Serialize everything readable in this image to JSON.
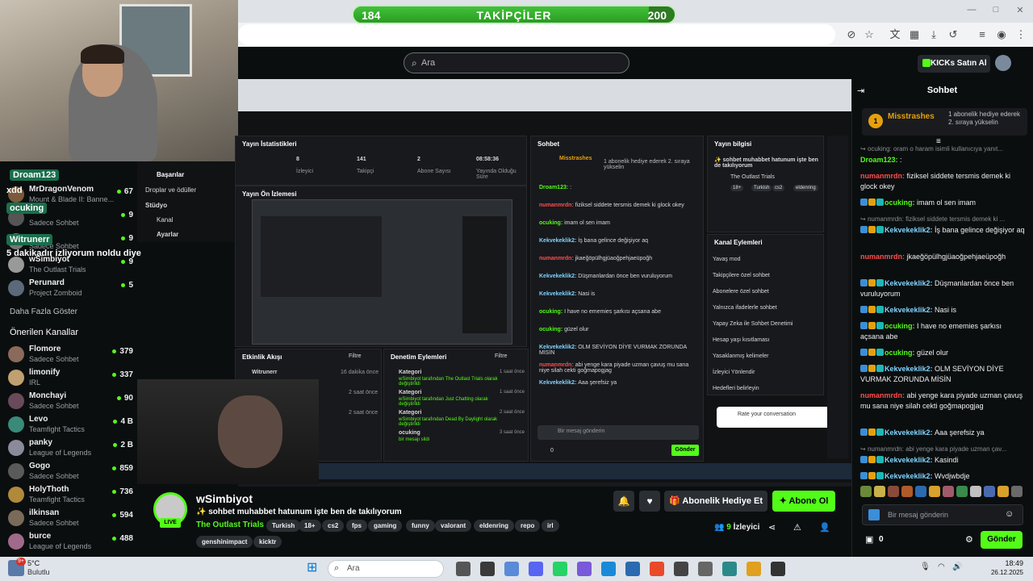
{
  "goal": {
    "title": "TAKİPÇİLER",
    "current": "184",
    "target": "200",
    "progress": 0.92
  },
  "header": {
    "search_placeholder": "Ara",
    "buy_kicks": "KICKs Satın Al"
  },
  "overlay": {
    "labels": [
      "Droam123",
      "xdd",
      "ocuking",
      "Witrunerr",
      "5 dakikadır izliyorum noldu diye"
    ]
  },
  "sidebar": {
    "followed": [
      {
        "name": "MrDragonVenom",
        "category": "Mount & Blade II: Banne...",
        "viewers": "67",
        "color": "#7a5a3a"
      },
      {
        "name": "",
        "category": "Sadece Sohbet",
        "viewers": "9",
        "color": "#555"
      },
      {
        "name": "",
        "category": "Sadece Sohbet",
        "viewers": "9",
        "color": "#777"
      },
      {
        "name": "wSimbiyot",
        "category": "The Outlast Trials",
        "viewers": "9",
        "color": "#999"
      },
      {
        "name": "Perunard",
        "category": "Project Zomboid",
        "viewers": "5",
        "color": "#5a6a7a"
      }
    ],
    "show_more": "Daha Fazla Göster",
    "recommended_title": "Önerilen Kanallar",
    "recommended": [
      {
        "name": "Flomore",
        "category": "Sadece Sohbet",
        "viewers": "379",
        "color": "#8a6a5a"
      },
      {
        "name": "limonify",
        "category": "IRL",
        "viewers": "337",
        "color": "#c0a070"
      },
      {
        "name": "Monchayi",
        "category": "Sadece Sohbet",
        "viewers": "90",
        "color": "#6a4a5a"
      },
      {
        "name": "Levo",
        "category": "Teamfight Tactics",
        "viewers": "4 B",
        "color": "#3a8a7a"
      },
      {
        "name": "panky",
        "category": "League of Legends",
        "viewers": "2 B",
        "color": "#8a8a9a"
      },
      {
        "name": "Gogo",
        "category": "Sadece Sohbet",
        "viewers": "859",
        "color": "#5a5a5a"
      },
      {
        "name": "HolyThoth",
        "category": "Teamfight Tactics",
        "viewers": "736",
        "color": "#b08a3a"
      },
      {
        "name": "ilkinsan",
        "category": "Sadece Sohbet",
        "viewers": "594",
        "color": "#7a6a5a"
      },
      {
        "name": "burce",
        "category": "League of Legends",
        "viewers": "488",
        "color": "#a06a8a"
      }
    ]
  },
  "inner": {
    "stats_title": "Yayın İstatistikleri",
    "stats": [
      {
        "v": "8",
        "l": "İzleyici"
      },
      {
        "v": "141",
        "l": "Takipçi"
      },
      {
        "v": "2",
        "l": "Abone Sayısı"
      },
      {
        "v": "08:58:36",
        "l": "Yayında Olduğu Süre"
      }
    ],
    "preview_title": "Yayın Ön İzlemesi",
    "menu": [
      "Başarılar",
      "Droplar ve ödüller",
      "Stüdyo",
      "Kanal",
      "Ayarlar"
    ],
    "activity_title": "Etkinlik Akışı",
    "activity_filter": "Filtre",
    "activity": [
      {
        "u": "Witrunerr",
        "t": "16 dakika önce"
      },
      {
        "u": "",
        "t": "2 saat önce"
      },
      {
        "u": "",
        "t": "2 saat önce"
      }
    ],
    "moderation_title": "Denetim Eylemleri",
    "moderation_filter": "Filtre",
    "moderation": [
      {
        "k": "Kategori",
        "d": "wSimbiyot tarafından The Outlast Trials olarak değiştirildi",
        "t": "1 saat önce"
      },
      {
        "k": "Kategori",
        "d": "wSimbiyot tarafından Just Chatting olarak değiştirildi",
        "t": "1 saat önce"
      },
      {
        "k": "Kategori",
        "d": "wSimbiyot tarafından Dead By Daylight olarak değiştirildi",
        "t": "2 saat önce"
      },
      {
        "k": "ocuking",
        "d": "bir mesajı sildi",
        "t": "3 saat önce"
      }
    ],
    "chat_title": "Sohbet",
    "info_title": "Yayın bilgisi",
    "info_stream_title": "✨ sohbet muhabbet hatunum işte ben de takılıyorum",
    "info_category": "The Outlast Trials",
    "info_tags": [
      "18+",
      "Turkish",
      "cs2",
      "eldenring"
    ],
    "actions_title": "Kanal Eylemleri",
    "actions": [
      "Yavaş mod",
      "Takipçilere özel sohbet",
      "Abonelere özel sohbet",
      "Yalnızca ifadelerle sohbet",
      "Yapay Zeka ile Sohbet Denetimi",
      "Hesap yaşı kısıtlaması",
      "Yasaklanmış kelimeler",
      "İzleyici Yönlendir",
      "Hedefleri belirleyin"
    ],
    "chat_input": "Bir mesaj gönderin",
    "send": "Gönder",
    "rate": "Rate your conversation",
    "inner_count": "0"
  },
  "stream": {
    "streamer": "wSimbiyot",
    "live": "LIVE",
    "title": "✨ sohbet muhabbet hatunum işte ben de takılıyorum",
    "category": "The Outlast Trials",
    "tags": [
      "Turkish",
      "18+",
      "cs2",
      "fps",
      "gaming",
      "funny",
      "valorant",
      "eldenring",
      "repo",
      "irl",
      "genshinimpact",
      "kicktr"
    ],
    "gift_label": "Abonelik Hediye Et",
    "sub_label": "Abone Ol",
    "viewers": "9",
    "viewers_label": "İzleyici"
  },
  "chat": {
    "title": "Sohbet",
    "pinned_user": "Misstrashes",
    "pinned_count": "1",
    "pinned_text": "1 abonelik hediye ederek 2. sıraya yükselin",
    "messages": [
      {
        "reply": "ocuking: oram o haram isimli kullanıcıya yanıt...",
        "user": "Droam123",
        "text": ":",
        "color": "#53fc18",
        "badges": []
      },
      {
        "user": "numanmrdn",
        "text": "fiziksel siddete tersmis demek ki glock okey",
        "color": "#ff4d4d",
        "badges": []
      },
      {
        "user": "ocuking",
        "text": "imam ol sen imam",
        "color": "#53fc18",
        "badges": [
          "#3a8fd8",
          "#e5a00d",
          "#1fb6b6"
        ]
      },
      {
        "reply": "numanmrdn: fiziksel siddete tersmis demek ki ...",
        "user": "Kekvekeklik2",
        "text": "İş bana gelince değişiyor aq",
        "color": "#7fd3ff",
        "badges": [
          "#3a8fd8",
          "#e5a00d",
          "#1fb6b6"
        ]
      },
      {
        "user": "numanmrdn",
        "text": "jkaeğöpülhgjüaoğpehjaeüpoğh",
        "color": "#ff4d4d",
        "badges": []
      },
      {
        "user": "Kekvekeklik2",
        "text": "Düşmanlardan önce ben vuruluyorum",
        "color": "#7fd3ff",
        "badges": [
          "#3a8fd8",
          "#e5a00d",
          "#1fb6b6"
        ]
      },
      {
        "user": "Kekvekeklik2",
        "text": "Nasi is",
        "color": "#7fd3ff",
        "badges": [
          "#3a8fd8",
          "#e5a00d",
          "#1fb6b6"
        ]
      },
      {
        "user": "ocuking",
        "text": "I have no ememies şarkısı açsana abe",
        "color": "#53fc18",
        "badges": [
          "#3a8fd8",
          "#e5a00d",
          "#1fb6b6"
        ]
      },
      {
        "user": "ocuking",
        "text": "güzel olur",
        "color": "#53fc18",
        "badges": [
          "#3a8fd8",
          "#e5a00d",
          "#1fb6b6"
        ]
      },
      {
        "user": "Kekvekeklik2",
        "text": "OLM SEVİYON DİYE VURMAK ZORUNDA MİSİN",
        "color": "#7fd3ff",
        "badges": [
          "#3a8fd8",
          "#e5a00d",
          "#1fb6b6"
        ]
      },
      {
        "user": "numanmrdn",
        "text": "abi yenge kara piyade uzman çavuş mu sana niye silah cekti goğmapogjag",
        "color": "#ff4d4d",
        "badges": []
      },
      {
        "user": "Kekvekeklik2",
        "text": "Aaa şerefsiz ya",
        "color": "#7fd3ff",
        "badges": [
          "#3a8fd8",
          "#e5a00d",
          "#1fb6b6"
        ]
      },
      {
        "reply": "numanmrdn: abi yenge kara piyade uzman çav...",
        "user": "Kekvekeklik2",
        "text": "Kasindi",
        "color": "#7fd3ff",
        "badges": [
          "#3a8fd8",
          "#e5a00d",
          "#1fb6b6"
        ]
      },
      {
        "user": "Kekvekeklik2",
        "text": "Wvdjwbdje",
        "color": "#7fd3ff",
        "badges": [
          "#3a8fd8",
          "#e5a00d",
          "#1fb6b6"
        ]
      }
    ],
    "input_placeholder": "Bir mesaj gönderin",
    "points": "0",
    "send_label": "Gönder"
  },
  "taskbar": {
    "weather_temp": "5°C",
    "weather_desc": "Bulutlu",
    "search_placeholder": "Ara",
    "time": "18:49",
    "date": "26.12.2025",
    "notif": "9+"
  }
}
